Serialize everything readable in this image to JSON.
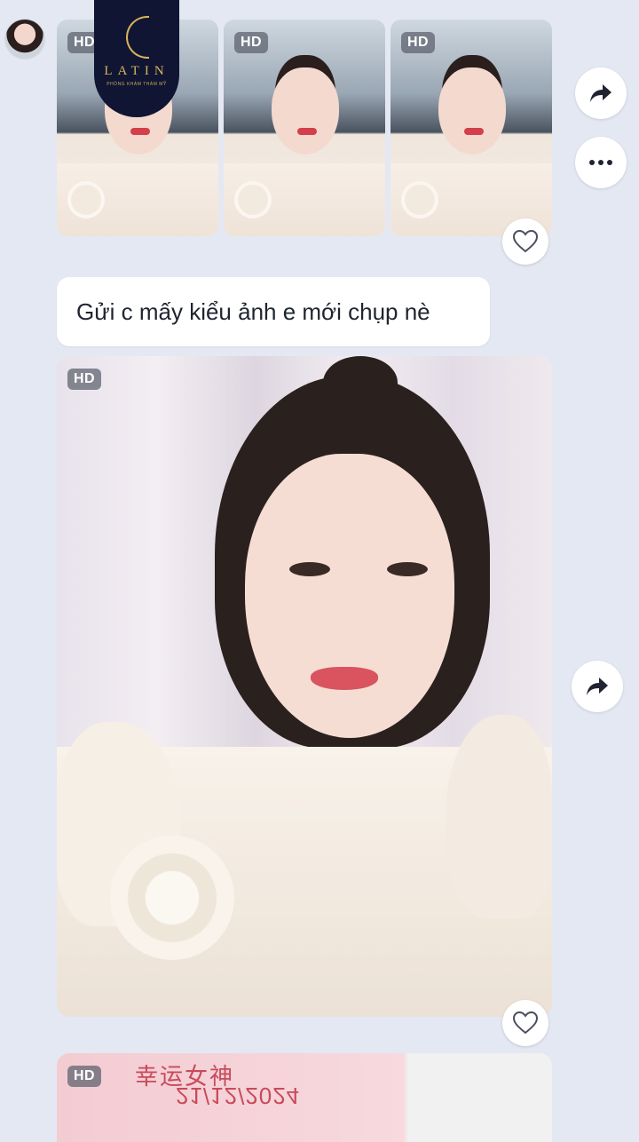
{
  "colors": {
    "background": "#e4e8f2",
    "bubble": "#ffffff",
    "hd_badge": "rgba(90,96,108,0.72)",
    "logo_bg": "#0f1533",
    "logo_gold": "#d9b45a",
    "stamp_red": "#c94a5a"
  },
  "logo": {
    "name": "LATIN",
    "tagline": "PHÒNG KHÁM THẨM MỸ"
  },
  "thumbnails": [
    {
      "badge": "HD"
    },
    {
      "badge": "HD"
    },
    {
      "badge": "HD"
    }
  ],
  "message": {
    "text": "Gửi c mấy kiểu ảnh e mới chụp nè"
  },
  "large_photo": {
    "badge": "HD"
  },
  "bottom_photo": {
    "badge": "HD",
    "stamp_text": "幸运女神",
    "stamp_date": "21/12/2024"
  },
  "icons": {
    "share": "share-arrow-icon",
    "more": "more-dots-icon",
    "like": "heart-outline-icon"
  }
}
